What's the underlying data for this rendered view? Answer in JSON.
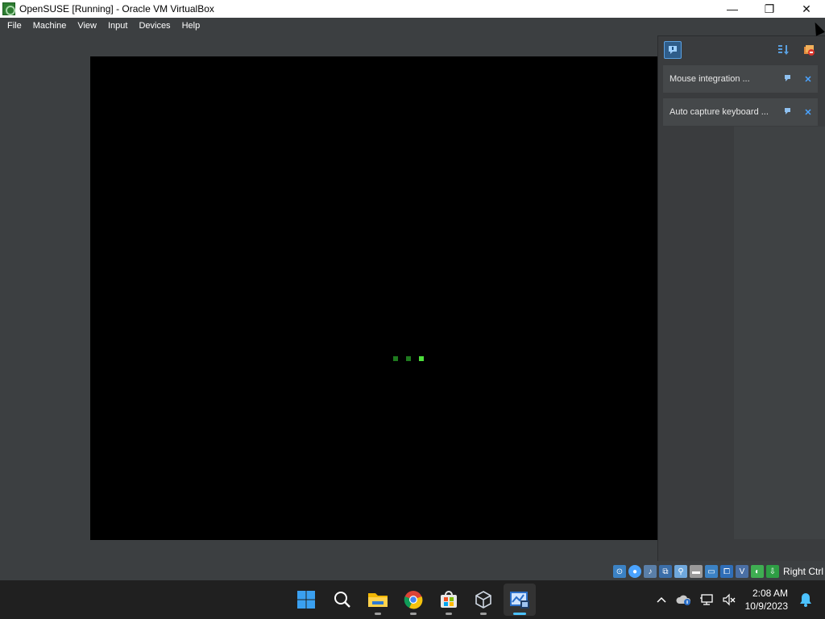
{
  "window": {
    "title": "OpenSUSE [Running] - Oracle VM VirtualBox",
    "minimize_glyph": "—",
    "maximize_glyph": "❐",
    "close_glyph": "✕"
  },
  "menu": {
    "items": [
      "File",
      "Machine",
      "View",
      "Input",
      "Devices",
      "Help"
    ]
  },
  "notifications": {
    "items": [
      {
        "label": "Mouse integration ..."
      },
      {
        "label": "Auto capture keyboard ..."
      }
    ]
  },
  "statusbar": {
    "host_key": "Right Ctrl",
    "icons": [
      "hard-disk-icon",
      "optical-drive-icon",
      "audio-icon",
      "network-icon",
      "usb-icon",
      "shared-folders-icon",
      "display-icon",
      "recording-icon",
      "cpu-icon",
      "mouse-integration-icon",
      "keyboard-capture-icon"
    ]
  },
  "taskbar": {
    "apps": [
      "windows-start",
      "search",
      "file-explorer",
      "chrome",
      "microsoft-store",
      "virtualbox",
      "virtualbox-vm-window"
    ]
  },
  "clock": {
    "time": "2:08 AM",
    "date": "10/9/2023"
  },
  "colors": {
    "accent": "#4cc2ff",
    "loader_dim": "#1e7a1e",
    "loader_bright": "#4ddf3c",
    "panel_bg": "#3a3c3e",
    "vm_bg": "#000000"
  }
}
